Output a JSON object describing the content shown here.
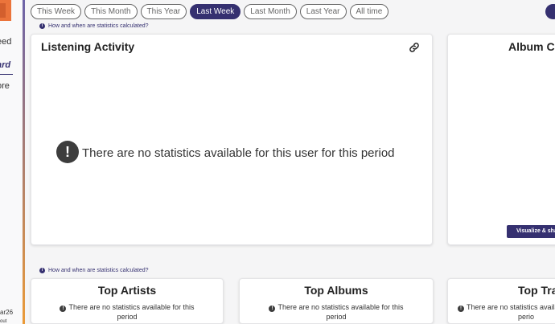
{
  "sidebar": {
    "items": [
      {
        "label": "eed",
        "active": false
      },
      {
        "label": "ard",
        "active": true
      },
      {
        "label": "ore",
        "active": false
      }
    ],
    "username": "ar26",
    "logout": "out"
  },
  "ranges": {
    "tabs": [
      "This Week",
      "This Month",
      "This Year",
      "Last Week",
      "Last Month",
      "Last Year",
      "All time"
    ],
    "selected": "Last Week"
  },
  "info": {
    "stats_link": "How and when are statistics calculated?",
    "info_glyph": "i"
  },
  "listening": {
    "title": "Listening Activity",
    "empty_message": "There are no statistics available for this user for this period",
    "icon": "link-icon"
  },
  "album_cover": {
    "title": "Album Co",
    "button": "Visualize & sha"
  },
  "top_artists": {
    "title": "Top Artists",
    "empty_line1": "There are no statistics available for this",
    "empty_line2": "period"
  },
  "top_albums": {
    "title": "Top Albums",
    "empty_line1": "There are no statistics available for this",
    "empty_line2": "period"
  },
  "top_tracks": {
    "title": "Top Tra",
    "empty_line1": "There are no statistics available fo",
    "empty_line2": "perio"
  },
  "colors": {
    "accent": "#353070",
    "brand_orange": "#eb743b",
    "background": "#f5f5f6"
  }
}
